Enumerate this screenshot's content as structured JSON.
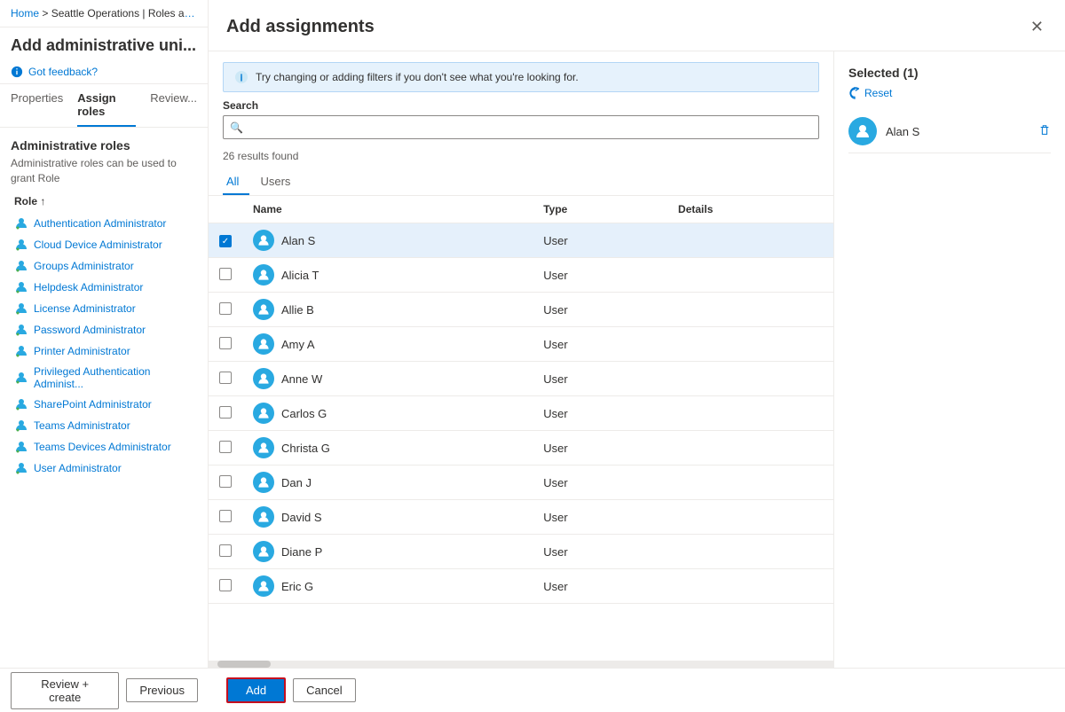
{
  "breadcrumb": {
    "home": "Home",
    "separator": ">",
    "current": "Seattle Operations | Roles and..."
  },
  "left_panel": {
    "page_title": "Add administrative uni...",
    "feedback": "Got feedback?",
    "tabs": [
      {
        "label": "Properties",
        "active": false
      },
      {
        "label": "Assign roles",
        "active": true
      },
      {
        "label": "Review...",
        "active": false
      }
    ],
    "admin_roles_section": {
      "title": "Administrative roles",
      "description": "Administrative roles can be used to grant Role",
      "role_header": "Role ↑",
      "roles": [
        "Authentication Administrator",
        "Cloud Device Administrator",
        "Groups Administrator",
        "Helpdesk Administrator",
        "License Administrator",
        "Password Administrator",
        "Printer Administrator",
        "Privileged Authentication Administ...",
        "SharePoint Administrator",
        "Teams Administrator",
        "Teams Devices Administrator",
        "User Administrator"
      ]
    },
    "footer_buttons": {
      "review_create": "Review + create",
      "previous": "Previous"
    }
  },
  "modal": {
    "title": "Add assignments",
    "info_text": "Try changing or adding filters if you don't see what you're looking for.",
    "search": {
      "label": "Search",
      "placeholder": ""
    },
    "results_count": "26 results found",
    "filter_tabs": [
      {
        "label": "All",
        "active": true
      },
      {
        "label": "Users",
        "active": false
      }
    ],
    "table": {
      "columns": [
        "",
        "Name",
        "Type",
        "Details"
      ],
      "rows": [
        {
          "checked": true,
          "name": "Alan S",
          "type": "User",
          "details": ""
        },
        {
          "checked": false,
          "name": "Alicia T",
          "type": "User",
          "details": ""
        },
        {
          "checked": false,
          "name": "Allie B",
          "type": "User",
          "details": ""
        },
        {
          "checked": false,
          "name": "Amy A",
          "type": "User",
          "details": ""
        },
        {
          "checked": false,
          "name": "Anne W",
          "type": "User",
          "details": ""
        },
        {
          "checked": false,
          "name": "Carlos G",
          "type": "User",
          "details": ""
        },
        {
          "checked": false,
          "name": "Christa G",
          "type": "User",
          "details": ""
        },
        {
          "checked": false,
          "name": "Dan J",
          "type": "User",
          "details": ""
        },
        {
          "checked": false,
          "name": "David S",
          "type": "User",
          "details": ""
        },
        {
          "checked": false,
          "name": "Diane P",
          "type": "User",
          "details": ""
        },
        {
          "checked": false,
          "name": "Eric G",
          "type": "User",
          "details": ""
        }
      ]
    },
    "selected_panel": {
      "title": "Selected (1)",
      "reset_label": "Reset",
      "selected_users": [
        {
          "name": "Alan S"
        }
      ]
    },
    "footer": {
      "add_label": "Add",
      "cancel_label": "Cancel"
    }
  },
  "colors": {
    "primary": "#0078d4",
    "user_avatar": "#29a9e1",
    "checked_bg": "#0078d4",
    "info_bg": "#e6f2fc",
    "selected_row": "#e5f0fb",
    "add_border": "#c50f1f"
  }
}
